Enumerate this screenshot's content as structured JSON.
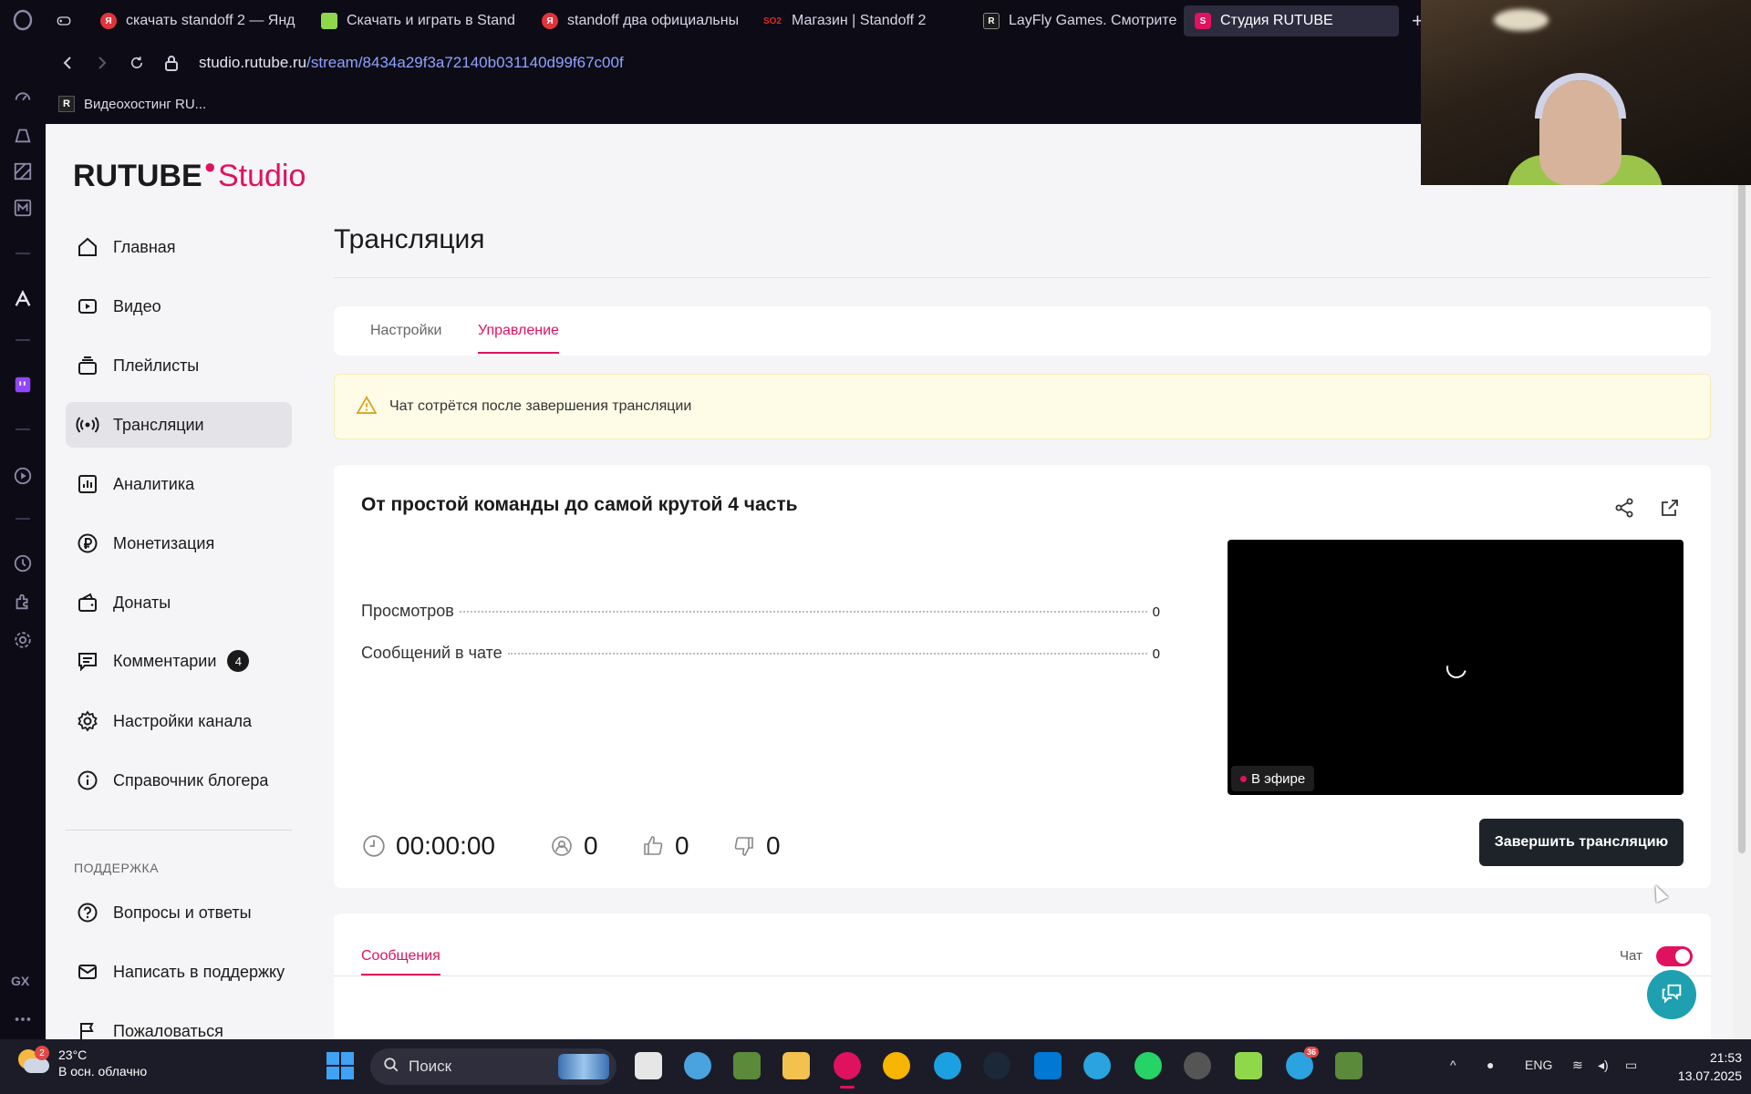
{
  "browser": {
    "tabs": [
      {
        "label": "скачать standoff 2 — Янд",
        "favicon": "yandex-icon",
        "color": "#e0343c"
      },
      {
        "label": "Скачать и играть в Stand",
        "favicon": "bluestacks-icon",
        "color": "#8fd84a"
      },
      {
        "label": "standoff два официальны",
        "favicon": "yandex-icon",
        "color": "#e0343c"
      },
      {
        "label": "Магазин | Standoff 2",
        "favicon": "so2-icon",
        "favicon_text": "SO2",
        "color": "#d62b2b"
      },
      {
        "label": "LayFly Games. Смотрите",
        "favicon": "rutube-icon",
        "favicon_text": "R",
        "color": "#222"
      },
      {
        "label": "Студия RUTUBE",
        "favicon": "rutube-studio-icon",
        "favicon_text": "S",
        "color": "#e0115f"
      }
    ],
    "url_host": "studio.rutube.ru",
    "url_path": "/stream/8434a29f3a72140b031140d99f67c00f",
    "bookmark": {
      "label": "Видеохостинг RU...",
      "favicon_text": "R"
    }
  },
  "logo": {
    "main": "RUTUBE",
    "accent": "Studio"
  },
  "sidebar": {
    "items": [
      {
        "label": "Главная",
        "icon": "home-icon"
      },
      {
        "label": "Видео",
        "icon": "video-icon"
      },
      {
        "label": "Плейлисты",
        "icon": "playlist-icon"
      },
      {
        "label": "Трансляции",
        "icon": "broadcast-icon",
        "active": true
      },
      {
        "label": "Аналитика",
        "icon": "analytics-icon"
      },
      {
        "label": "Монетизация",
        "icon": "ruble-icon"
      },
      {
        "label": "Донаты",
        "icon": "wallet-icon"
      },
      {
        "label": "Комментарии",
        "icon": "comment-icon",
        "badge": "4"
      },
      {
        "label": "Настройки канала",
        "icon": "gear-icon"
      },
      {
        "label": "Справочник блогера",
        "icon": "info-icon"
      }
    ],
    "support_heading": "ПОДДЕРЖКА",
    "support_items": [
      {
        "label": "Вопросы и ответы",
        "icon": "question-icon"
      },
      {
        "label": "Написать в поддержку",
        "icon": "mail-icon"
      },
      {
        "label": "Пожаловаться",
        "icon": "flag-icon"
      }
    ]
  },
  "main": {
    "title": "Трансляция",
    "tabs": [
      {
        "label": "Настройки",
        "active": false
      },
      {
        "label": "Управление",
        "active": true
      }
    ],
    "warning": "Чат сотрётся после завершения трансляции",
    "stream": {
      "title": "От простой команды до самой крутой 4 часть",
      "stats": [
        {
          "label": "Просмотров",
          "value": "0"
        },
        {
          "label": "Сообщений в чате",
          "value": "0"
        }
      ],
      "live_label": "В эфире",
      "duration": "00:00:00",
      "viewers": "0",
      "likes": "0",
      "dislikes": "0",
      "end_button": "Завершить трансляцию"
    },
    "messages": {
      "tab": "Сообщения",
      "chat_label": "Чат",
      "chat_enabled": true
    }
  },
  "taskbar": {
    "weather_temp": "23°C",
    "weather_desc": "В осн. облачно",
    "weather_badge": "2",
    "search_placeholder": "Поиск",
    "telegram_badge": "36",
    "language": "ENG",
    "time": "21:53",
    "date": "13.07.2025"
  },
  "colors": {
    "accent": "#e0115f",
    "button_dark": "#1e2329",
    "warning_bg": "#fefbe6"
  }
}
